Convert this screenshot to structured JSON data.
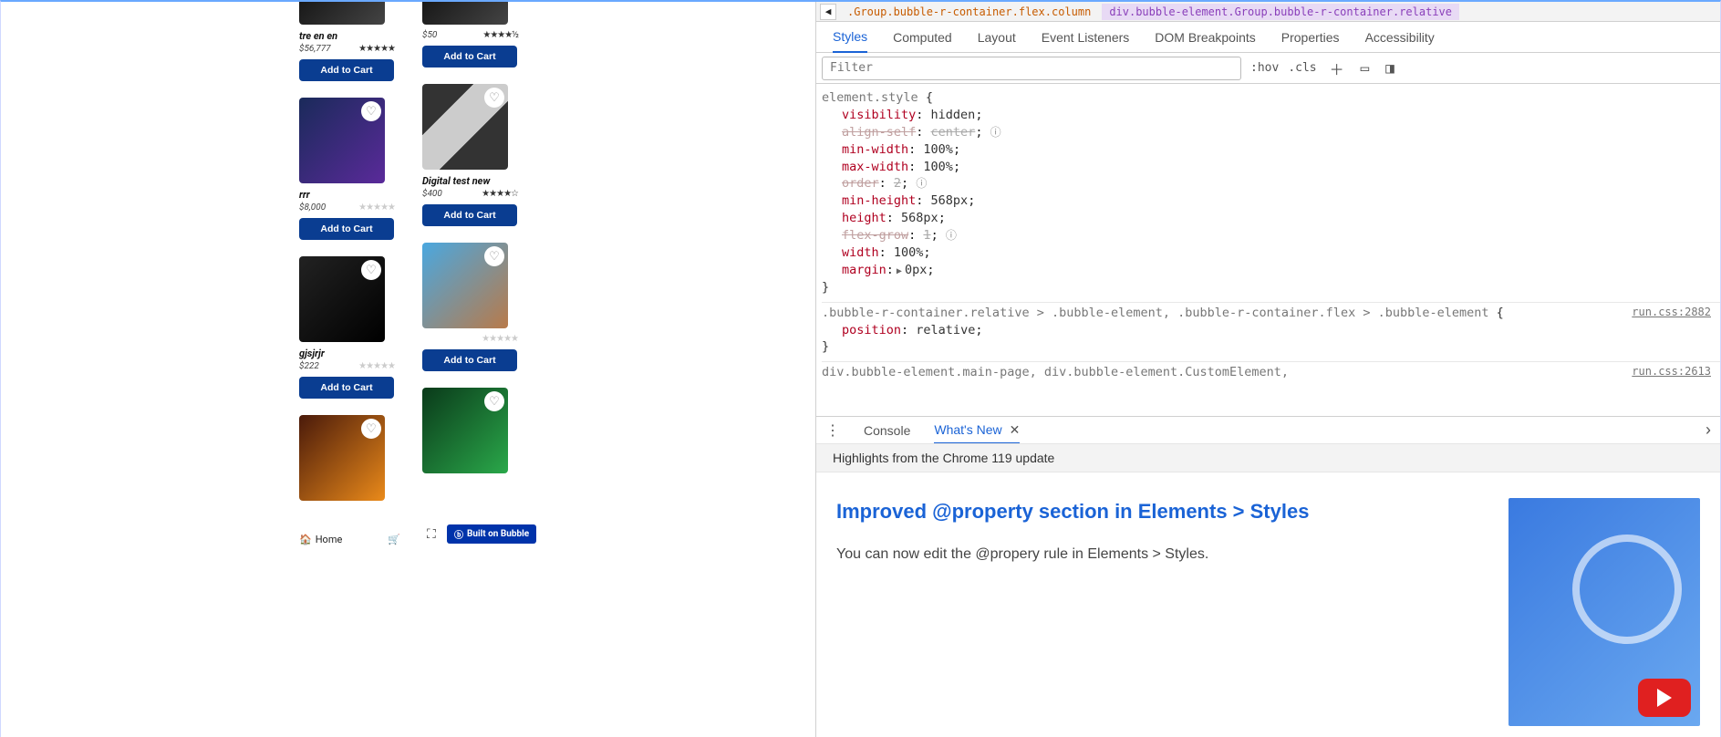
{
  "app": {
    "products": [
      {
        "name": "tre en en",
        "price": "$56,777",
        "stars": "★★★★★",
        "faded": false,
        "btn": "Add to Cart"
      },
      {
        "name": "",
        "price": "$50",
        "stars": "★★★★½",
        "faded": false,
        "btn": "Add to Cart"
      },
      {
        "name": "rrr",
        "price": "$8,000",
        "stars": "★★★★★",
        "faded": true,
        "btn": "Add to Cart"
      },
      {
        "name": "Digital test new",
        "price": "$400",
        "stars": "★★★★☆",
        "faded": false,
        "btn": "Add to Cart"
      },
      {
        "name": "gjsjrjr",
        "price": "$222",
        "stars": "★★★★★",
        "faded": true,
        "btn": "Add to Cart"
      },
      {
        "name": "",
        "price": "",
        "stars": "★★★★★",
        "faded": true,
        "btn": "Add to Cart"
      }
    ],
    "nav": {
      "home": "Home"
    },
    "builtOn": "Built on Bubble"
  },
  "devtools": {
    "breadcrumb": {
      "seg1": ".Group.bubble-r-container.flex.column",
      "seg2": "div.bubble-element.Group.bubble-r-container.relative"
    },
    "tabs": [
      "Styles",
      "Computed",
      "Layout",
      "Event Listeners",
      "DOM Breakpoints",
      "Properties",
      "Accessibility"
    ],
    "activeTab": 0,
    "filterPlaceholder": "Filter",
    "toolbar": {
      "hov": ":hov",
      "cls": ".cls"
    },
    "rules": [
      {
        "selector": "element.style",
        "props": [
          {
            "name": "visibility",
            "value": "hidden",
            "disabled": false
          },
          {
            "name": "align-self",
            "value": "center",
            "disabled": true,
            "info": true
          },
          {
            "name": "min-width",
            "value": "100%",
            "disabled": false
          },
          {
            "name": "max-width",
            "value": "100%",
            "disabled": false
          },
          {
            "name": "order",
            "value": "2",
            "disabled": true,
            "info": true
          },
          {
            "name": "min-height",
            "value": "568px",
            "disabled": false
          },
          {
            "name": "height",
            "value": "568px",
            "disabled": false
          },
          {
            "name": "flex-grow",
            "value": "1",
            "disabled": true,
            "info": true
          },
          {
            "name": "width",
            "value": "100%",
            "disabled": false
          },
          {
            "name": "margin",
            "value": "0px",
            "disabled": false,
            "expand": true
          }
        ]
      },
      {
        "selector": ".bubble-r-container.relative > .bubble-element, .bubble-r-container.flex > .bubble-element",
        "source": "run.css:2882",
        "props": [
          {
            "name": "position",
            "value": "relative",
            "disabled": false
          }
        ]
      },
      {
        "selector": "div.bubble-element.main-page, div.bubble-element.CustomElement,",
        "source": "run.css:2613",
        "props": []
      }
    ],
    "consoleTabs": {
      "console": "Console",
      "whatsnew": "What's New"
    },
    "whatsnew": {
      "highlights": "Highlights from the Chrome 119 update",
      "title": "Improved @property section in Elements > Styles",
      "body": "You can now edit the @propery rule in Elements > Styles."
    }
  }
}
